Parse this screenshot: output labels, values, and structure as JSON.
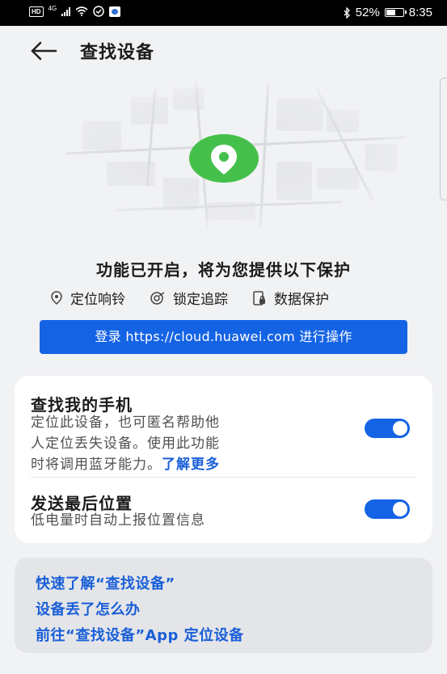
{
  "status_bar": {
    "hd_label": "HD",
    "network_label": "4G",
    "battery_percent": "52%",
    "battery_level": 0.52,
    "time": "8:35"
  },
  "header": {
    "title": "查找设备"
  },
  "status": {
    "title": "功能已开启，将为您提供以下保护",
    "features": [
      {
        "icon": "location-pin-icon",
        "label": "定位响铃"
      },
      {
        "icon": "lock-track-icon",
        "label": "锁定追踪"
      },
      {
        "icon": "data-protect-icon",
        "label": "数据保护"
      }
    ]
  },
  "login_button": {
    "label": "登录 https://cloud.huawei.com 进行操作"
  },
  "settings": {
    "find_phone": {
      "title": "查找我的手机",
      "line1": "定位此设备，也可匿名帮助他",
      "line2": "人定位丢失设备。使用此功能",
      "line3": "时将调用蓝牙能力。",
      "link": "了解更多",
      "enabled": true
    },
    "last_location": {
      "title": "发送最后位置",
      "desc": "低电量时自动上报位置信息",
      "enabled": true
    }
  },
  "help_links": [
    "快速了解“查找设备”",
    "设备丢了怎么办",
    "前往“查找设备”App 定位设备"
  ],
  "colors": {
    "accent": "#1563e5",
    "pin": "#45c04b",
    "background": "#f1f2f4"
  }
}
